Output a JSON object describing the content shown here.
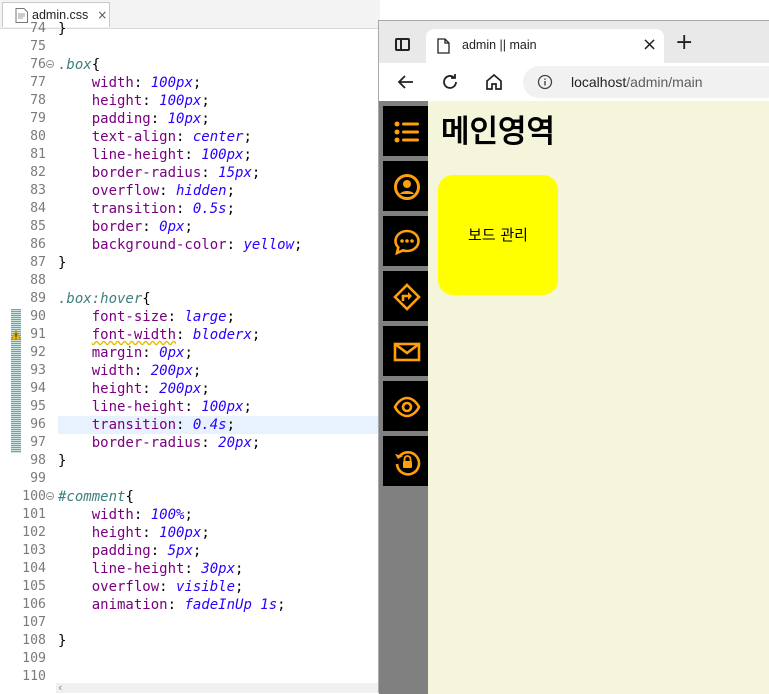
{
  "editor": {
    "tab_label": "admin.css",
    "tab_close": "×",
    "lines": [
      {
        "n": "74",
        "t": "}",
        "kind": "plain"
      },
      {
        "n": "75",
        "t": "",
        "kind": "plain"
      },
      {
        "n": "76",
        "sel": ".box",
        "rest": "{",
        "fold": true
      },
      {
        "n": "77",
        "p": "width",
        "v": "100px"
      },
      {
        "n": "78",
        "p": "height",
        "v": "100px"
      },
      {
        "n": "79",
        "p": "padding",
        "v": "10px"
      },
      {
        "n": "80",
        "p": "text-align",
        "v": "center"
      },
      {
        "n": "81",
        "p": "line-height",
        "v": "100px"
      },
      {
        "n": "82",
        "p": "border-radius",
        "v": "15px"
      },
      {
        "n": "83",
        "p": "overflow",
        "v": "hidden"
      },
      {
        "n": "84",
        "p": "transition",
        "v": "0.5s"
      },
      {
        "n": "85",
        "p": "border",
        "v": "0px"
      },
      {
        "n": "86",
        "p": "background-color",
        "v": "yellow"
      },
      {
        "n": "87",
        "t": "}",
        "kind": "plain"
      },
      {
        "n": "88",
        "t": "",
        "kind": "plain"
      },
      {
        "n": "89",
        "sel": ".box:hover",
        "rest": "{"
      },
      {
        "n": "90",
        "p": "font-size",
        "v": "large"
      },
      {
        "n": "91",
        "p": "font-width",
        "v": "bloderx",
        "warn": true
      },
      {
        "n": "92",
        "p": "margin",
        "v": "0px"
      },
      {
        "n": "93",
        "p": "width",
        "v": "200px"
      },
      {
        "n": "94",
        "p": "height",
        "v": "200px"
      },
      {
        "n": "95",
        "p": "line-height",
        "v": "100px"
      },
      {
        "n": "96",
        "p": "transition",
        "v": "0.4s",
        "hl": true
      },
      {
        "n": "97",
        "p": "border-radius",
        "v": "20px"
      },
      {
        "n": "98",
        "t": "}",
        "kind": "plain"
      },
      {
        "n": "99",
        "t": "",
        "kind": "plain"
      },
      {
        "n": "100",
        "sel": "#comment",
        "rest": "{",
        "fold": true
      },
      {
        "n": "101",
        "p": "width",
        "v": "100%"
      },
      {
        "n": "102",
        "p": "height",
        "v": "100px"
      },
      {
        "n": "103",
        "p": "padding",
        "v": "5px"
      },
      {
        "n": "104",
        "p": "line-height",
        "v": "30px"
      },
      {
        "n": "105",
        "p": "overflow",
        "v": "visible"
      },
      {
        "n": "106",
        "p": "animation",
        "v": "fadeInUp 1s"
      },
      {
        "n": "107",
        "t": "",
        "kind": "plain"
      },
      {
        "n": "108",
        "t": "}",
        "kind": "plain"
      },
      {
        "n": "109",
        "t": "",
        "kind": "plain"
      },
      {
        "n": "110",
        "t": "",
        "kind": "plain"
      }
    ]
  },
  "browser": {
    "tab_title": "admin || main",
    "tab_close": "×",
    "new_tab": "+",
    "url_host": "localhost",
    "url_path": "/admin/main",
    "page_title": "메인영역",
    "box_label": "보드 관리",
    "nav_icons": [
      "list-icon",
      "user-circle-icon",
      "chat-bubble-icon",
      "directions-icon",
      "mail-icon",
      "eye-icon",
      "lock-reset-icon"
    ],
    "colors": {
      "accent": "#ff9f0a",
      "nav_bg": "#000000",
      "main_bg": "#f5f5dc",
      "box_bg": "#ffff00",
      "frame_bg": "#808080"
    }
  }
}
